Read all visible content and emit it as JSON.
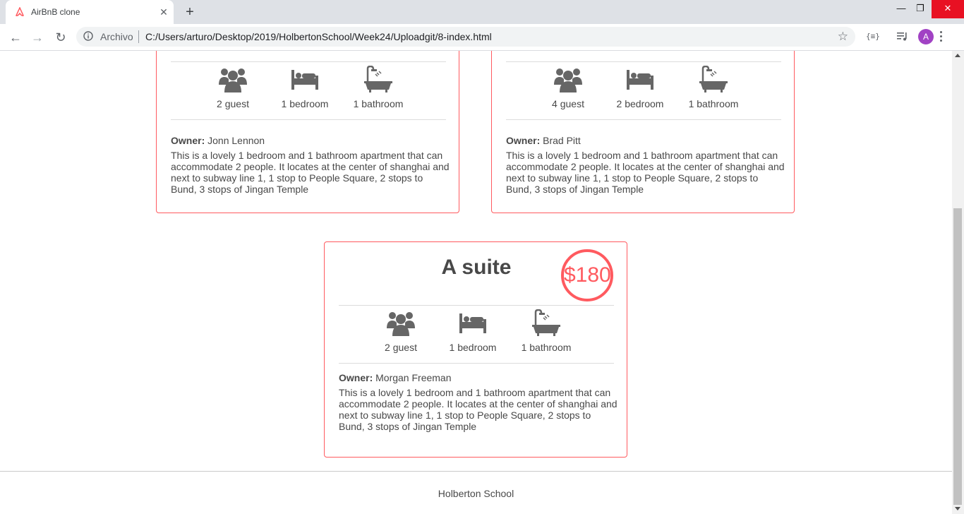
{
  "browser": {
    "tab_title": "AirBnB clone",
    "tab_close": "✕",
    "new_tab": "+",
    "scheme_label": "Archivo",
    "url": "C:/Users/arturo/Desktop/2019/HolbertonSchool/Week24/Uploadgit/8-index.html",
    "ext_label": "{≡}",
    "avatar_letter": "A",
    "window_buttons": {
      "minimize": "—",
      "restore": "❐",
      "close": "✕"
    }
  },
  "places": [
    {
      "title": "",
      "price": "",
      "guests": "2 guest",
      "bedrooms": "1 bedroom",
      "bathrooms": "1 bathroom",
      "owner_label": "Owner:",
      "owner": "Jonn Lennon",
      "description": "This is a lovely 1 bedroom and 1 bathroom apartment that can accommodate 2 people. It locates at the center of shanghai and next to subway line 1, 1 stop to People Square, 2 stops to Bund, 3 stops of Jingan Temple"
    },
    {
      "title": "",
      "price": "",
      "guests": "4 guest",
      "bedrooms": "2 bedroom",
      "bathrooms": "1 bathroom",
      "owner_label": "Owner:",
      "owner": "Brad Pitt",
      "description": "This is a lovely 1 bedroom and 1 bathroom apartment that can accommodate 2 people. It locates at the center of shanghai and next to subway line 1, 1 stop to People Square, 2 stops to Bund, 3 stops of Jingan Temple"
    },
    {
      "title": "A suite",
      "price": "$180",
      "guests": "2 guest",
      "bedrooms": "1 bedroom",
      "bathrooms": "1 bathroom",
      "owner_label": "Owner:",
      "owner": "Morgan Freeman",
      "description": "This is a lovely 1 bedroom and 1 bathroom apartment that can accommodate 2 people. It locates at the center of shanghai and next to subway line 1, 1 stop to People Square, 2 stops to Bund, 3 stops of Jingan Temple"
    }
  ],
  "footer": {
    "text": "Holberton School"
  },
  "colors": {
    "accent": "#ff5a5f",
    "text": "#484848",
    "icon": "#666666"
  }
}
